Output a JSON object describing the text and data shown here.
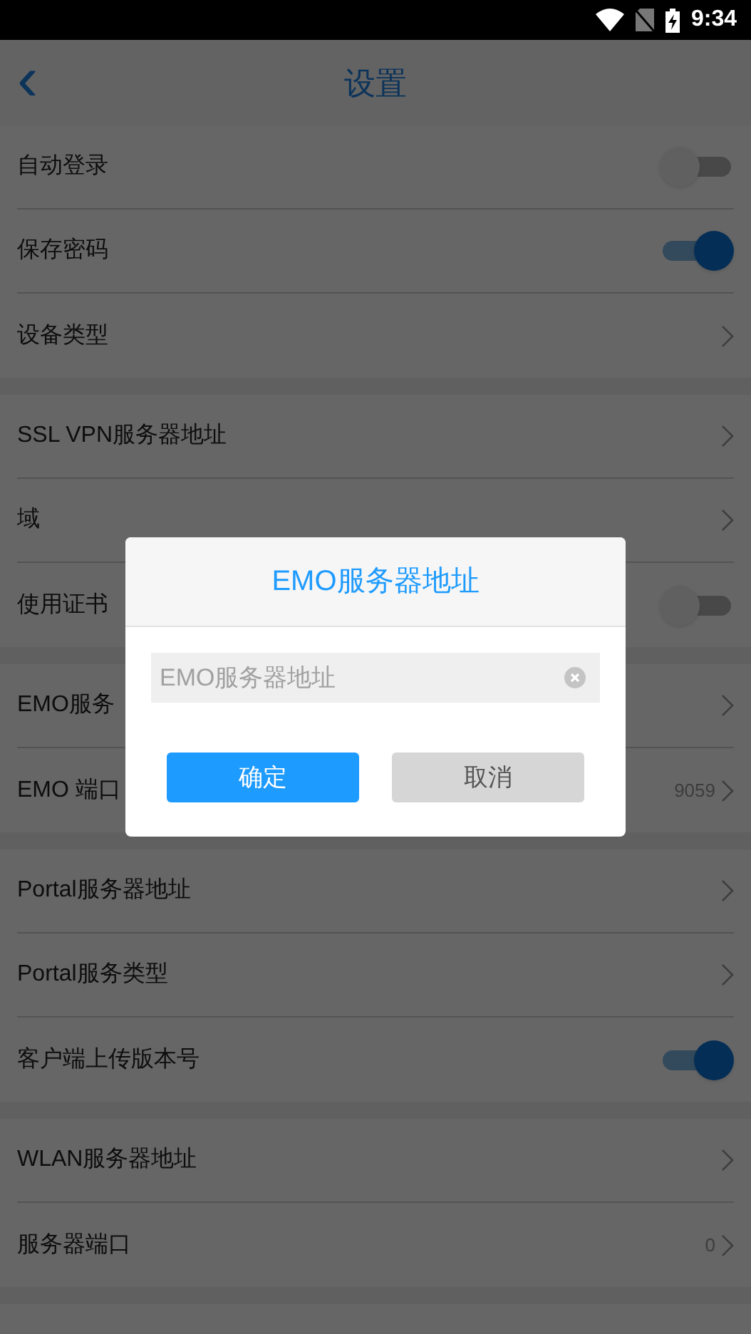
{
  "status_bar": {
    "time": "9:34"
  },
  "header": {
    "title": "设置",
    "back": "‹"
  },
  "groups": [
    {
      "rows": [
        {
          "kind": "toggle",
          "label": "自动登录",
          "on": false
        },
        {
          "kind": "toggle",
          "label": "保存密码",
          "on": true
        },
        {
          "kind": "link",
          "label": "设备类型"
        }
      ]
    },
    {
      "rows": [
        {
          "kind": "link",
          "label": "SSL VPN服务器地址"
        },
        {
          "kind": "link",
          "label": "域"
        },
        {
          "kind": "toggle",
          "label": "使用证书",
          "on": false
        }
      ]
    },
    {
      "rows": [
        {
          "kind": "link",
          "label": "EMO服务"
        },
        {
          "kind": "link",
          "label": "EMO 端口",
          "value": "9059"
        }
      ]
    },
    {
      "rows": [
        {
          "kind": "link",
          "label": "Portal服务器地址"
        },
        {
          "kind": "link",
          "label": "Portal服务类型"
        },
        {
          "kind": "toggle",
          "label": "客户端上传版本号",
          "on": true
        }
      ]
    },
    {
      "rows": [
        {
          "kind": "link",
          "label": "WLAN服务器地址"
        },
        {
          "kind": "link",
          "label": "服务器端口",
          "value": "0"
        }
      ]
    }
  ],
  "dialog": {
    "title": "EMO服务器地址",
    "field": {
      "placeholder": "EMO服务器地址"
    },
    "buttons": [
      {
        "kind": "primary",
        "label": "确定"
      },
      {
        "kind": "secondary",
        "label": "取消"
      }
    ]
  }
}
